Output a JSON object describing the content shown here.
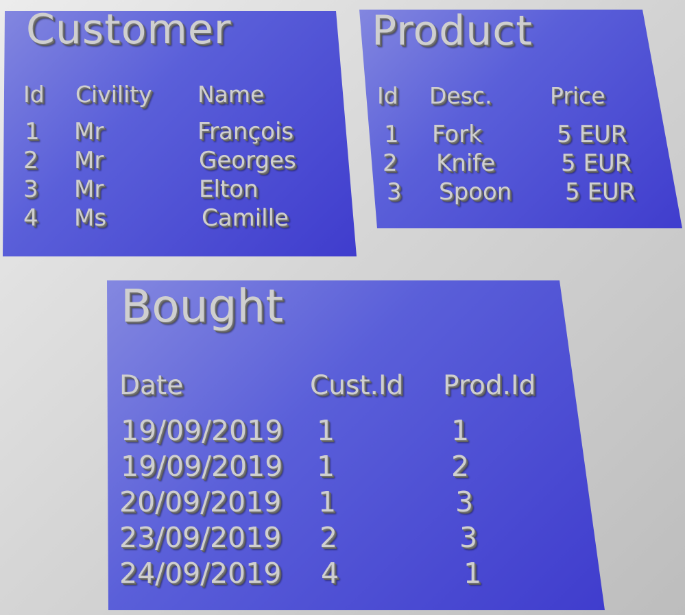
{
  "customer": {
    "title": "Customer",
    "headers": [
      "Id",
      "Civility",
      "Name"
    ],
    "rows": [
      [
        "1",
        "Mr",
        "François"
      ],
      [
        "2",
        "Mr",
        "Georges"
      ],
      [
        "3",
        "Mr",
        "Elton"
      ],
      [
        "4",
        "Ms",
        "Camille"
      ]
    ]
  },
  "product": {
    "title": "Product",
    "headers": [
      "Id",
      "Desc.",
      "Price"
    ],
    "rows": [
      [
        "1",
        "Fork",
        "5 EUR"
      ],
      [
        "2",
        "Knife",
        "5 EUR"
      ],
      [
        "3",
        "Spoon",
        "5 EUR"
      ]
    ]
  },
  "bought": {
    "title": "Bought",
    "headers": [
      "Date",
      "Cust.Id",
      "Prod.Id"
    ],
    "rows": [
      [
        "19/09/2019",
        "1",
        "1"
      ],
      [
        "19/09/2019",
        "1",
        "2"
      ],
      [
        "20/09/2019",
        "1",
        "3"
      ],
      [
        "23/09/2019",
        "2",
        "3"
      ],
      [
        "24/09/2019",
        "4",
        "1"
      ]
    ]
  },
  "colors": {
    "panel_light": "#8589e0",
    "panel_dark": "#3f3ccd",
    "text": "#cfcfcf"
  }
}
